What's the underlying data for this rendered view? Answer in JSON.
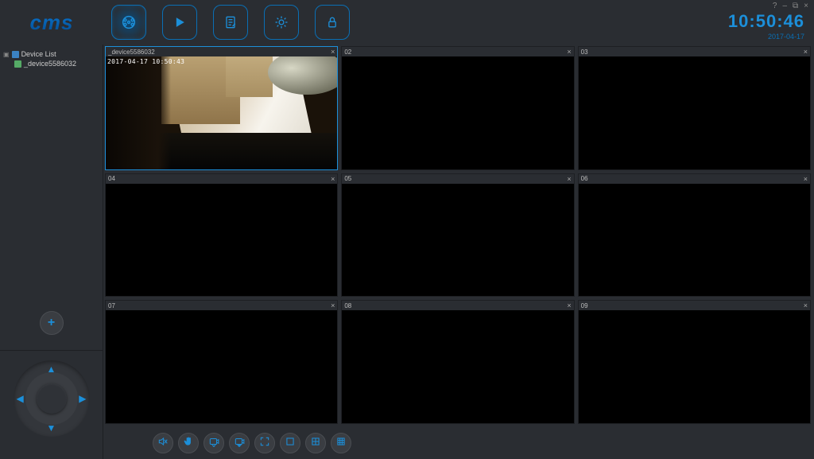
{
  "app": {
    "logo_text": "cms"
  },
  "window_controls": {
    "help": "?",
    "minimize": "–",
    "maximize": "⧉",
    "close": "×"
  },
  "clock": {
    "time": "10:50:46",
    "date": "2017-04-17"
  },
  "nav": {
    "live": {
      "icon": "live-view-icon"
    },
    "playback": {
      "icon": "play-icon"
    },
    "log": {
      "icon": "log-icon"
    },
    "settings": {
      "icon": "gear-icon"
    },
    "lock": {
      "icon": "lock-icon"
    }
  },
  "sidebar": {
    "root_label": "Device List",
    "device_label": "_device5586032",
    "add_label": "+"
  },
  "ptz": {
    "up": "▲",
    "down": "▼",
    "left": "◀",
    "right": "▶"
  },
  "grid": {
    "cells": [
      {
        "num": "",
        "title": "_device5586032",
        "osd": "2017-04-17  10:50:43",
        "active": true,
        "video": true
      },
      {
        "num": "02",
        "title": "",
        "osd": "",
        "active": false,
        "video": false
      },
      {
        "num": "03",
        "title": "",
        "osd": "",
        "active": false,
        "video": false
      },
      {
        "num": "04",
        "title": "",
        "osd": "",
        "active": false,
        "video": false
      },
      {
        "num": "05",
        "title": "",
        "osd": "",
        "active": false,
        "video": false
      },
      {
        "num": "06",
        "title": "",
        "osd": "",
        "active": false,
        "video": false
      },
      {
        "num": "07",
        "title": "",
        "osd": "",
        "active": false,
        "video": false
      },
      {
        "num": "08",
        "title": "",
        "osd": "",
        "active": false,
        "video": false
      },
      {
        "num": "09",
        "title": "",
        "osd": "",
        "active": false,
        "video": false
      }
    ],
    "close_glyph": "×"
  },
  "bottombar": {
    "buttons": [
      {
        "name": "mute-button",
        "icon": "mute-icon"
      },
      {
        "name": "hand-button",
        "icon": "hand-icon"
      },
      {
        "name": "snapshot-button",
        "icon": "camera-out-icon"
      },
      {
        "name": "record-button",
        "icon": "camera-in-icon"
      },
      {
        "name": "fullscreen-button",
        "icon": "expand-icon"
      },
      {
        "name": "layout-1-button",
        "icon": "layout-1-icon"
      },
      {
        "name": "layout-4-button",
        "icon": "layout-4-icon"
      },
      {
        "name": "layout-9-button",
        "icon": "layout-9-icon"
      }
    ]
  }
}
